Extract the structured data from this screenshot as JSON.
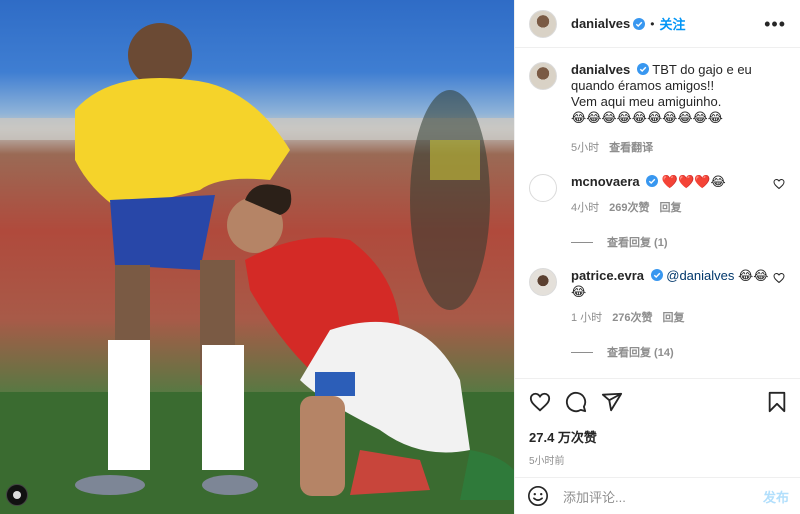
{
  "post": {
    "username": "danialves",
    "follow_label": "关注",
    "dot": "•",
    "more": "•••"
  },
  "caption": {
    "username": "danialves",
    "text_line1": "TBT do gajo e eu",
    "text_line2": "quando éramos amigos!!",
    "text_line3": "Vem aqui meu amiguinho.",
    "emojis": "😂😂😂😂😂😂😂😂😂😂",
    "time": "5小时",
    "translate": "查看翻译"
  },
  "comments": [
    {
      "username": "mcnovaera",
      "text": "❤️❤️❤️😂",
      "time": "4小时",
      "likes": "269次赞",
      "reply": "回复",
      "view_replies": "查看回复 (1)"
    },
    {
      "username": "patrice.evra",
      "mention": "@danialves",
      "text": "😂😂😂",
      "time": "1 小时",
      "likes": "276次赞",
      "reply": "回复",
      "view_replies": "查看回复 (14)"
    }
  ],
  "stats": {
    "likes": "27.4 万次赞",
    "time": "5小时前"
  },
  "composer": {
    "placeholder": "添加评论...",
    "post_label": "发布"
  },
  "icons": {
    "like": "heart-icon",
    "comment": "comment-icon",
    "share": "share-icon",
    "save": "bookmark-icon",
    "emoji": "emoji-icon"
  },
  "colors": {
    "accent": "#0095f6",
    "verified": "#3897f0",
    "post_disabled": "#b2dffc"
  }
}
